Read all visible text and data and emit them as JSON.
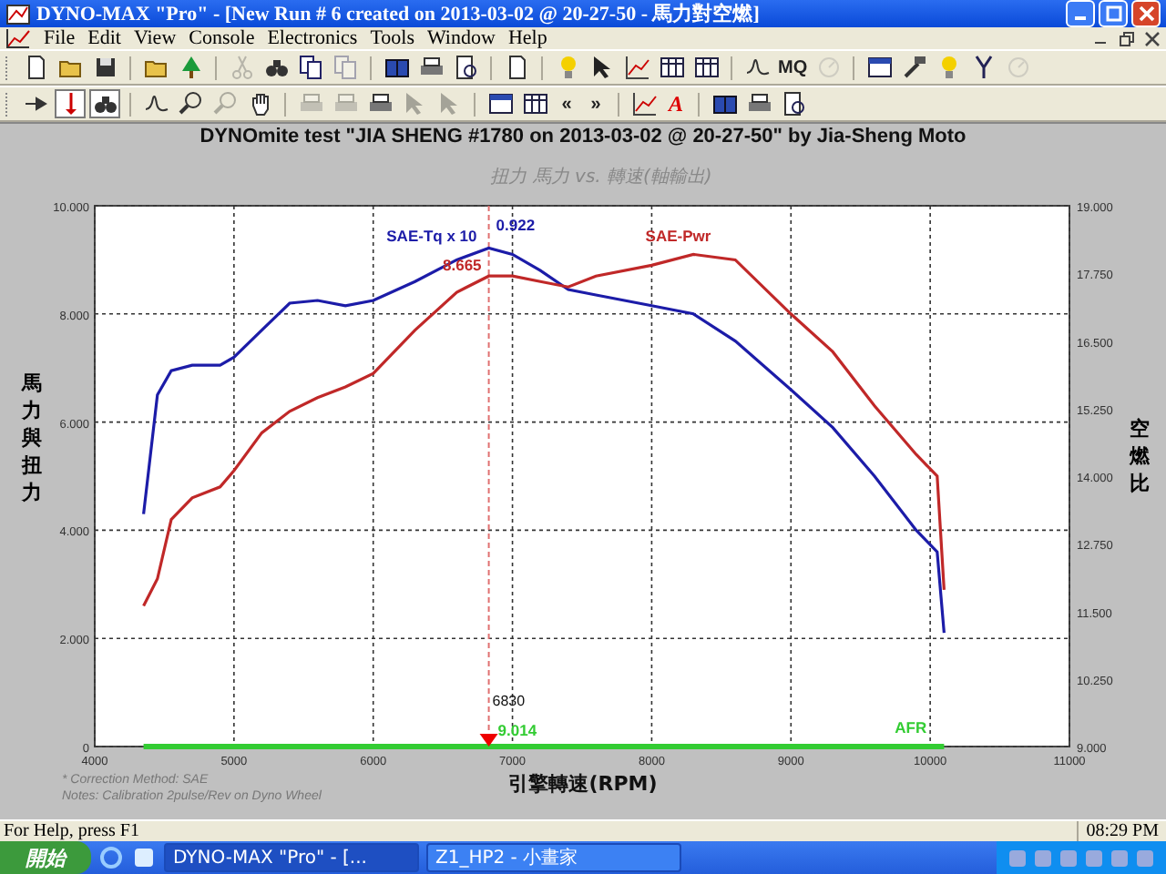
{
  "window": {
    "title": "DYNO-MAX \"Pro\" - [New Run # 6 created on 2013-03-02 @ 20-27-50 - 馬力對空燃]"
  },
  "menu": [
    {
      "label": "File"
    },
    {
      "label": "Edit"
    },
    {
      "label": "View"
    },
    {
      "label": "Console"
    },
    {
      "label": "Electronics"
    },
    {
      "label": "Tools"
    },
    {
      "label": "Window"
    },
    {
      "label": "Help"
    }
  ],
  "toolbar_1": [
    {
      "kind": "icon",
      "disabled": false
    },
    {
      "kind": "icon",
      "disabled": false
    },
    {
      "kind": "icon",
      "disabled": false
    },
    {
      "kind": "separator"
    },
    {
      "kind": "icon",
      "disabled": false
    },
    {
      "kind": "icon",
      "disabled": false
    },
    {
      "kind": "separator"
    },
    {
      "kind": "icon",
      "disabled": true
    },
    {
      "kind": "icon",
      "disabled": false
    },
    {
      "kind": "icon",
      "disabled": false
    },
    {
      "kind": "icon",
      "disabled": true
    },
    {
      "kind": "separator"
    },
    {
      "kind": "icon",
      "disabled": false
    },
    {
      "kind": "icon",
      "disabled": false
    },
    {
      "kind": "icon",
      "disabled": false
    },
    {
      "kind": "separator"
    },
    {
      "kind": "icon",
      "disabled": false
    },
    {
      "kind": "separator"
    },
    {
      "kind": "icon",
      "disabled": false
    },
    {
      "kind": "icon",
      "disabled": false
    },
    {
      "kind": "icon",
      "disabled": false
    },
    {
      "kind": "icon",
      "disabled": false
    },
    {
      "kind": "icon",
      "disabled": false
    },
    {
      "kind": "separator"
    },
    {
      "kind": "icon",
      "disabled": false
    },
    {
      "kind": "glyph",
      "text": "MQ",
      "disabled": false
    },
    {
      "kind": "icon",
      "disabled": true
    },
    {
      "kind": "separator"
    },
    {
      "kind": "icon",
      "disabled": false
    },
    {
      "kind": "icon",
      "disabled": false
    },
    {
      "kind": "icon",
      "disabled": false
    },
    {
      "kind": "icon",
      "disabled": false
    },
    {
      "kind": "icon",
      "disabled": true
    }
  ],
  "toolbar_2": [
    {
      "kind": "icon",
      "disabled": false,
      "pressed": false
    },
    {
      "kind": "icon",
      "disabled": false,
      "pressed": true
    },
    {
      "kind": "icon",
      "disabled": false,
      "pressed": true
    },
    {
      "kind": "separator"
    },
    {
      "kind": "icon",
      "disabled": false,
      "pressed": false
    },
    {
      "kind": "icon",
      "disabled": false,
      "pressed": false
    },
    {
      "kind": "icon",
      "disabled": true,
      "pressed": false
    },
    {
      "kind": "icon",
      "disabled": false,
      "pressed": false
    },
    {
      "kind": "separator"
    },
    {
      "kind": "icon",
      "disabled": true,
      "pressed": false
    },
    {
      "kind": "icon",
      "disabled": true,
      "pressed": false
    },
    {
      "kind": "icon",
      "disabled": false,
      "pressed": false
    },
    {
      "kind": "icon",
      "disabled": true,
      "pressed": false
    },
    {
      "kind": "icon",
      "disabled": true,
      "pressed": false
    },
    {
      "kind": "separator"
    },
    {
      "kind": "icon",
      "disabled": false,
      "pressed": false
    },
    {
      "kind": "icon",
      "disabled": false,
      "pressed": false
    },
    {
      "kind": "glyph",
      "text": "«",
      "disabled": false,
      "pressed": false
    },
    {
      "kind": "glyph",
      "text": "»",
      "disabled": false,
      "pressed": false
    },
    {
      "kind": "separator"
    },
    {
      "kind": "icon",
      "disabled": false,
      "pressed": false
    },
    {
      "kind": "glyph",
      "text": "A",
      "disabled": false,
      "pressed": false
    },
    {
      "kind": "separator"
    },
    {
      "kind": "icon",
      "disabled": false,
      "pressed": false
    },
    {
      "kind": "icon",
      "disabled": false,
      "pressed": false
    },
    {
      "kind": "icon",
      "disabled": false,
      "pressed": false
    }
  ],
  "chart_data": {
    "type": "line",
    "title": "DYNOmite test \"JIA SHENG #1780 on 2013-03-02 @ 20-27-50\" by Jia-Sheng Moto",
    "subtitle": "扭力 馬力 vs. 轉速(軸輸出)",
    "xlabel": "引擎轉速(RPM)",
    "ylabel": "馬力與扭力",
    "y2label": "空燃比",
    "x": [
      4350,
      4450,
      4550,
      4700,
      4900,
      5000,
      5200,
      5400,
      5600,
      5800,
      6000,
      6300,
      6600,
      6830,
      7000,
      7200,
      7400,
      7600,
      8000,
      8300,
      8600,
      9000,
      9300,
      9600,
      9900,
      10050,
      10100
    ],
    "xlim": [
      4000,
      11000
    ],
    "ylim": [
      0,
      10
    ],
    "y2lim": [
      9,
      19
    ],
    "xticks": [
      4000,
      5000,
      6000,
      7000,
      8000,
      9000,
      10000,
      11000
    ],
    "yticks": [
      {
        "value": 0,
        "label": "0"
      },
      {
        "value": 2,
        "label": "2.000"
      },
      {
        "value": 4,
        "label": "4.000"
      },
      {
        "value": 6,
        "label": "6.000"
      },
      {
        "value": 8,
        "label": "8.000"
      },
      {
        "value": 10,
        "label": "10.000"
      }
    ],
    "y2ticks": [
      {
        "value": 9,
        "label": "9.000"
      },
      {
        "value": 10.25,
        "label": "10.250"
      },
      {
        "value": 11.5,
        "label": "11.500"
      },
      {
        "value": 12.75,
        "label": "12.750"
      },
      {
        "value": 14,
        "label": "14.000"
      },
      {
        "value": 15.25,
        "label": "15.250"
      },
      {
        "value": 16.5,
        "label": "16.500"
      },
      {
        "value": 17.75,
        "label": "17.750"
      },
      {
        "value": 19,
        "label": "19.000"
      }
    ],
    "series": [
      {
        "name": "SAE-Tq x 10",
        "color": "#1c1ca8",
        "values": [
          4.3,
          6.5,
          6.95,
          7.05,
          7.05,
          7.2,
          7.7,
          8.2,
          8.25,
          8.15,
          8.25,
          8.6,
          9.0,
          9.22,
          9.1,
          8.8,
          8.45,
          8.35,
          8.15,
          8.0,
          7.5,
          6.6,
          5.9,
          5.0,
          4.0,
          3.6,
          2.1
        ]
      },
      {
        "name": "SAE-Pwr",
        "color": "#c02828",
        "values": [
          2.6,
          3.1,
          4.2,
          4.6,
          4.8,
          5.1,
          5.8,
          6.2,
          6.45,
          6.65,
          6.9,
          7.7,
          8.4,
          8.7,
          8.7,
          8.6,
          8.5,
          8.7,
          8.9,
          9.1,
          9.0,
          8.0,
          7.3,
          6.3,
          5.4,
          5.0,
          2.9
        ]
      },
      {
        "name": "AFR",
        "color": "#33cc33",
        "axis": "y2",
        "values": [
          9.0,
          9.0,
          9.0,
          9.0,
          9.0,
          9.0,
          9.0,
          9.0,
          9.0,
          9.0,
          9.0,
          9.0,
          9.0,
          9.0,
          9.0,
          9.0,
          9.0,
          9.0,
          9.0,
          9.0,
          9.0,
          9.0,
          9.0,
          9.0,
          9.0,
          9.0,
          9.0
        ]
      }
    ],
    "grid": true,
    "ref_lines": [
      {
        "axis": "x",
        "value": 6830
      }
    ],
    "annotations": [
      "0.922",
      "8.665",
      "6830",
      "9.014"
    ]
  },
  "notes": [
    "* Correction Method: SAE",
    "Notes: Calibration 2pulse/Rev on Dyno Wheel"
  ],
  "status_bar": {
    "text": "For Help, press F1",
    "time": "08:29 PM"
  },
  "taskbar": {
    "start": "開始",
    "tasks": [
      {
        "label": "DYNO-MAX \"Pro\" - [...",
        "selected": true
      },
      {
        "label": "Z1_HP2 - 小畫家",
        "selected": false
      }
    ]
  }
}
